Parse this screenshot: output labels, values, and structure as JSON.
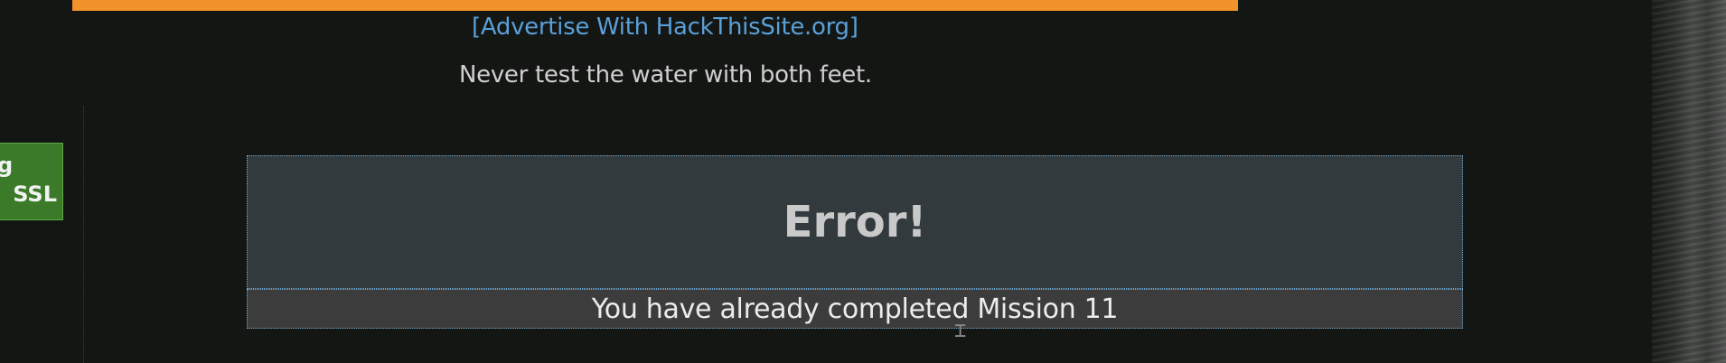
{
  "header": {
    "advertise_open_bracket": "[",
    "advertise_label": "Advertise With HackThisSite.org",
    "advertise_close_bracket": "]",
    "quote": "Never test the water with both feet."
  },
  "side_badge": {
    "line1": "g",
    "line2": "SSL"
  },
  "error": {
    "title": "Error!",
    "message": "You have already completed Mission 11"
  },
  "colors": {
    "background": "#141614",
    "banner": "#f0932b",
    "link": "#5a9fd8",
    "error_header_bg": "#323a3d",
    "error_body_bg": "#3c3c3c",
    "badge_bg": "#3a7a28"
  }
}
